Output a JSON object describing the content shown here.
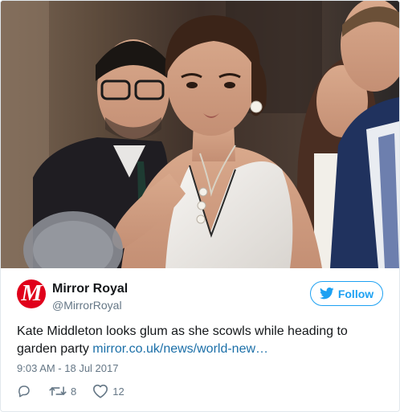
{
  "account": {
    "name": "Mirror Royal",
    "handle": "@MirrorRoyal",
    "avatar_letter": "M",
    "avatar_color": "#e0001b"
  },
  "follow": {
    "label": "Follow",
    "icon": "twitter-bird-icon",
    "color": "#1da1f2"
  },
  "tweet": {
    "text": "Kate Middleton looks glum as she scowls while heading to garden party",
    "link": "mirror.co.uk/news/world-new…",
    "link_color": "#1b6fa8",
    "timestamp": "9:03 AM - 18 Jul 2017"
  },
  "actions": {
    "reply_icon": "reply-icon",
    "retweet_icon": "retweet-icon",
    "retweet_count": "8",
    "like_icon": "heart-icon",
    "like_count": "12"
  }
}
